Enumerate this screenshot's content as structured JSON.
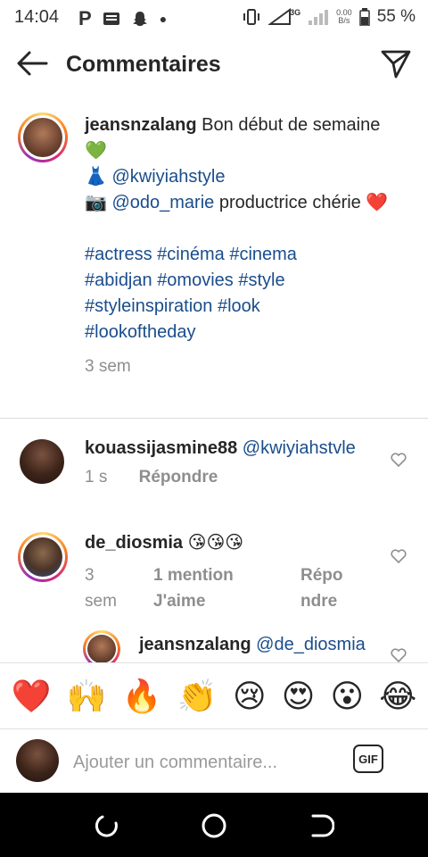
{
  "status": {
    "time": "14:04",
    "battery": "55 %",
    "network": "3G",
    "speed_value": "0.00",
    "speed_unit": "B/s"
  },
  "header": {
    "title": "Commentaires"
  },
  "caption": {
    "username": "jeansnzalang",
    "line1": "Bon début de semaine 💚",
    "dress": "👗",
    "mention1": "@kwiyiahstyle",
    "camera": "📷",
    "mention2": "@odo_marie",
    "line3": "productrice chérie ❤️",
    "hashtags": [
      "#actress",
      "#cinéma",
      "#cinema",
      "#abidjan",
      "#omovies",
      "#style",
      "#styleinspiration",
      "#look",
      "#lookoftheday"
    ],
    "time": "3 sem"
  },
  "comments": [
    {
      "username": "kouassijasmine88",
      "text": "@kwiyiahstvle",
      "time": "1 s",
      "reply": "Répondre"
    },
    {
      "username": "de_diosmia",
      "text": "😘😘😘",
      "time": "3 sem",
      "likes": "1 mention J'aime",
      "reply": "Répondre"
    },
    {
      "username": "jeansnzalang",
      "text": "@de_diosmia"
    }
  ],
  "emojis": [
    "❤️",
    "🙌",
    "🔥",
    "👏",
    "😢",
    "😍",
    "😮",
    "😂"
  ],
  "input": {
    "placeholder": "Ajouter un commentaire...",
    "gif": "GIF"
  }
}
